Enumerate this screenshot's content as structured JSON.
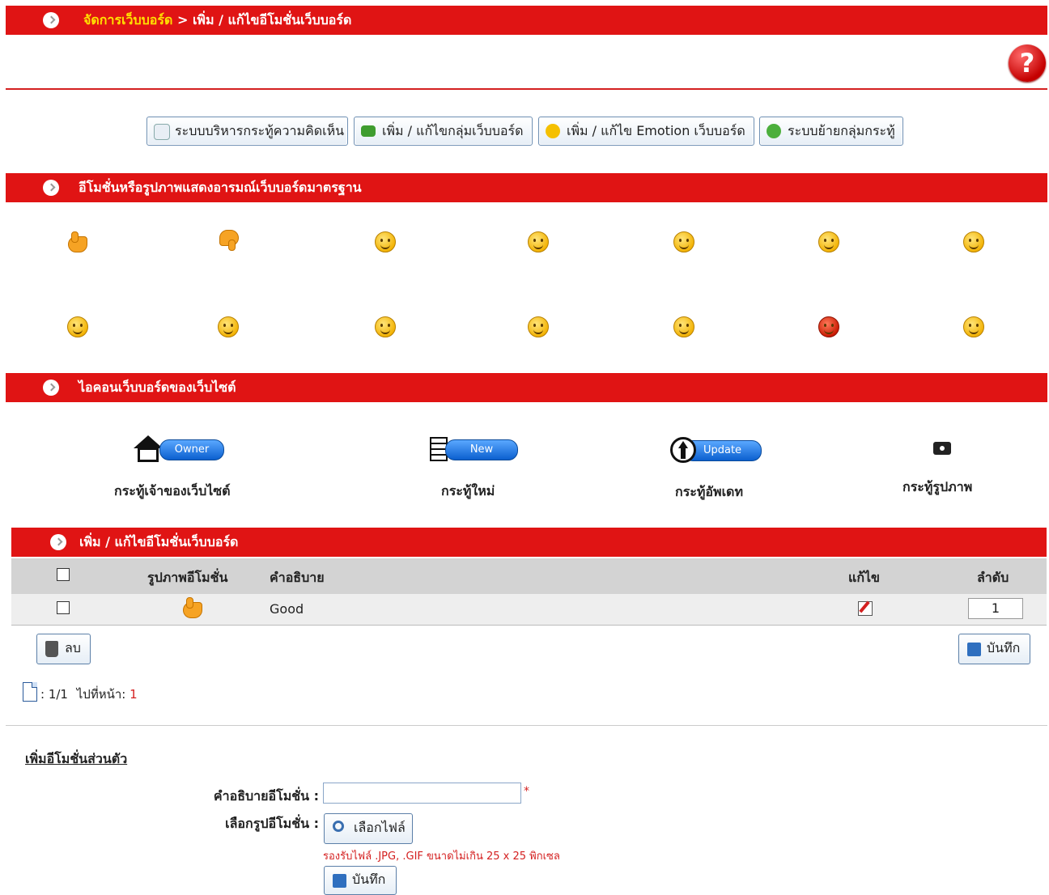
{
  "breadcrumb": {
    "link": "จัดการเว็บบอร์ด",
    "separator": ">",
    "current": "เพิ่ม / แก้ไขอีโมชั่นเว็บบอร์ด"
  },
  "help": {
    "glyph": "?"
  },
  "nav": [
    {
      "label": "ระบบบริหารกระทู้ความคิดเห็น",
      "icon": "comment-icon"
    },
    {
      "label": "เพิ่ม / แก้ไขกลุ่มเว็บบอร์ด",
      "icon": "folder-icon"
    },
    {
      "label": "เพิ่ม / แก้ไข Emotion เว็บบอร์ด",
      "icon": "smiley-icon"
    },
    {
      "label": "ระบบย้ายกลุ่มกระทู้",
      "icon": "refresh-icon"
    }
  ],
  "emotions_section": {
    "title": "อีโมชั่นหรือรูปภาพแสดงอารมณ์เว็บบอร์ดมาตรฐาน"
  },
  "icons_section": {
    "title": "ไอคอนเว็บบอร์ดของเว็บไซต์",
    "items": [
      {
        "badge": "Owner",
        "label": "กระทู้เจ้าของเว็บไซต์",
        "icon": "house-icon"
      },
      {
        "badge": "New",
        "label": "กระทู้ใหม่",
        "icon": "document-icon"
      },
      {
        "badge": "Update",
        "label": "กระทู้อัพเดท",
        "icon": "up-arrow-icon"
      },
      {
        "badge": "",
        "label": "กระทู้รูปภาพ",
        "icon": "camera-icon"
      }
    ]
  },
  "edit_section": {
    "title": "เพิ่ม / แก้ไขอีโมชั่นเว็บบอร์ด",
    "columns": {
      "image": "รูปภาพอีโมชั่น",
      "desc": "คำอธิบาย",
      "edit": "แก้ไข",
      "order": "ลำดับ"
    },
    "rows": [
      {
        "desc": "Good",
        "order": "1"
      }
    ],
    "delete_label": "ลบ",
    "save_label": "บันทึก",
    "pagination": {
      "pages": ": 1/1",
      "goto": "ไปที่หน้า:",
      "current": "1"
    }
  },
  "add_form": {
    "heading": "เพิ่มอีโมชั่นส่วนตัว",
    "desc_label": "คำอธิบายอีโมชั่น :",
    "desc_value": "",
    "required": "*",
    "file_label": "เลือกรูปอีโมชั่น :",
    "choose_label": "เลือกไฟล์",
    "hint": "รองรับไฟล์ .JPG, .GIF ขนาดไม่เกิน 25 x 25 พิกเซล",
    "save_label": "บันทึก"
  },
  "colors": {
    "bar": "#e01414",
    "link": "#ffe100",
    "hint": "#d42020"
  }
}
